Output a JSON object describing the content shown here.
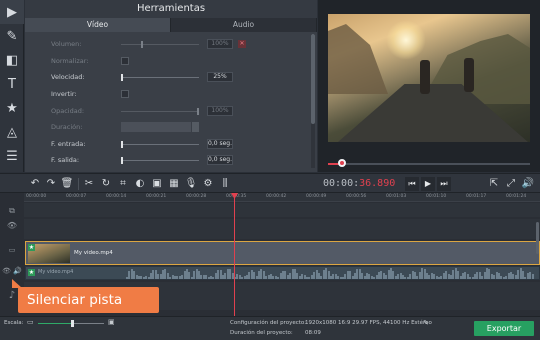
{
  "tools_sidebar": {
    "items": [
      {
        "name": "import-media",
        "icon": "film-import-icon",
        "glyph": "▶"
      },
      {
        "name": "magic-enhance",
        "icon": "magic-wand-icon",
        "glyph": "✎"
      },
      {
        "name": "transitions",
        "icon": "transitions-icon",
        "glyph": "◧"
      },
      {
        "name": "titles",
        "icon": "titles-icon",
        "glyph": "T"
      },
      {
        "name": "stickers",
        "icon": "star-sticker-icon",
        "glyph": "★"
      },
      {
        "name": "callouts",
        "icon": "shapes-icon",
        "glyph": "◬"
      },
      {
        "name": "more-tools",
        "icon": "menu-icon",
        "glyph": "☰"
      }
    ]
  },
  "panel": {
    "title": "Herramientas",
    "tabs": [
      {
        "label": "Vídeo",
        "active": true
      },
      {
        "label": "Audio",
        "active": false
      }
    ],
    "settings": {
      "volume": {
        "label": "Volumen:",
        "value": "100%",
        "enabled": false
      },
      "normalize": {
        "label": "Normalizar:",
        "enabled": false
      },
      "speed": {
        "label": "Velocidad:",
        "value": "25%",
        "enabled": true
      },
      "reverse": {
        "label": "Invertir:",
        "enabled": true
      },
      "opacity": {
        "label": "Opacidad:",
        "value": "100%",
        "enabled": false
      },
      "duration": {
        "label": "Duración:",
        "enabled": false
      },
      "fade_in": {
        "label": "F. entrada:",
        "value": "0,0 seg.",
        "enabled": true
      },
      "fade_out": {
        "label": "F. salida:",
        "value": "0,0 seg.",
        "enabled": true
      }
    }
  },
  "toolbar": {
    "undo": "↶",
    "redo": "↷",
    "delete": "🗑",
    "cut": "✂",
    "rotate": "↻",
    "crop": "⌗",
    "color": "◐",
    "image": "▣",
    "stabilize": "▦",
    "record": "🎙",
    "highlight": "⚙",
    "equalizer": "⫼"
  },
  "timecode": {
    "main": "00:00:",
    "highlight": "36.890"
  },
  "playback": {
    "prev": "⏮",
    "play": "▶",
    "next": "⏭"
  },
  "preview_controls": {
    "detach": "⇱",
    "fullscreen": "⤢",
    "volume": "🔊"
  },
  "ruler_ticks": [
    "00:00:00",
    "00:00:07",
    "00:00:14",
    "00:00:21",
    "00:00:28",
    "00:00:35",
    "00:00:42",
    "00:00:49",
    "00:00:56",
    "00:01:03",
    "00:01:10",
    "00:01:17",
    "00:01:24"
  ],
  "timeline": {
    "video_clip_label": "My video.mp4",
    "audio_clip_label": "My video.mp4"
  },
  "tooltip": "Silenciar pista",
  "status": {
    "zoom_label": "Escala:",
    "zoom_level": 0.52,
    "project_settings_label": "Configuración del proyecto:",
    "project_settings_value": "1920x1080 16:9 29.97 FPS, 44100 Hz Estéreo",
    "project_duration_label": "Duración del proyecto:",
    "project_duration_value": "08:09",
    "export_label": "Exportar"
  },
  "colors": {
    "accent_red": "#e0414f",
    "export_green": "#27a061",
    "tooltip_orange": "#f07c45",
    "clip_border": "#dba642"
  }
}
